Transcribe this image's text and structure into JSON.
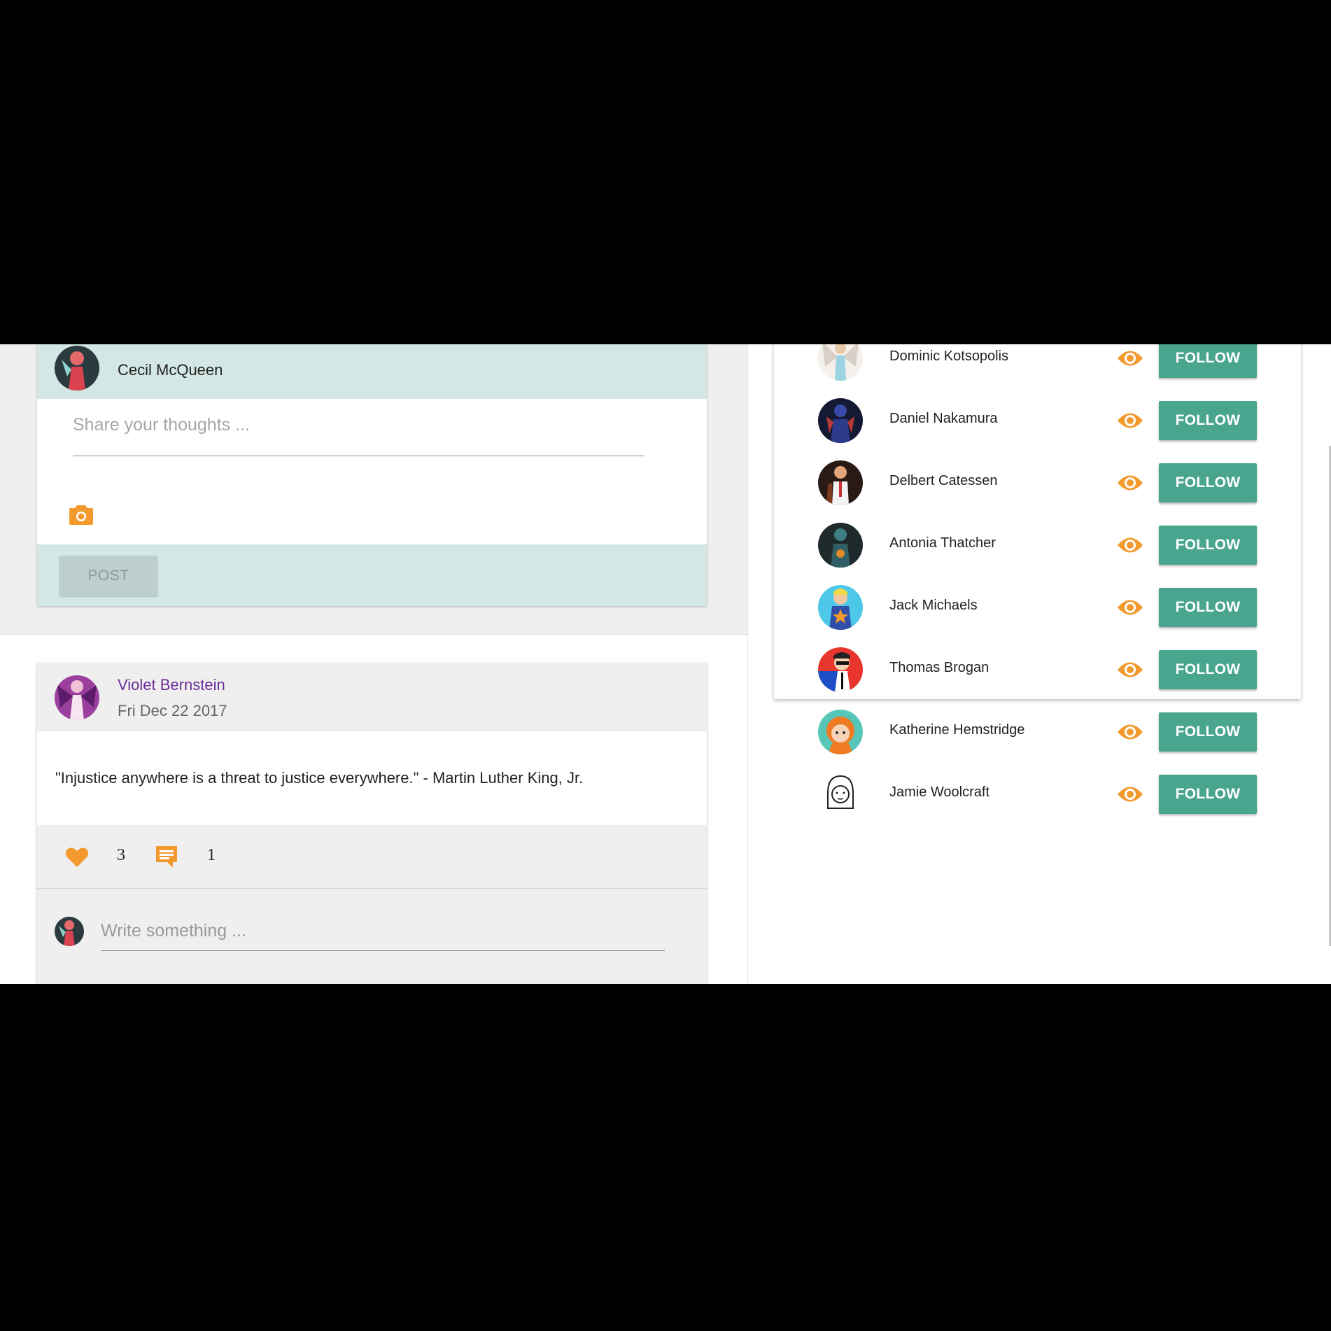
{
  "composer": {
    "user_name": "Cecil McQueen",
    "placeholder": "Share your thoughts ...",
    "post_label": "POST",
    "camera_icon": "camera-icon"
  },
  "post": {
    "author": "Violet Bernstein",
    "date": "Fri Dec 22 2017",
    "text": "\"Injustice anywhere is a threat to justice everywhere.\" - Martin Luther King, Jr.",
    "likes": "3",
    "comments": "1",
    "comment_placeholder": "Write something ..."
  },
  "suggestions": [
    {
      "name": "Dominic Kotsopolis",
      "follow": "FOLLOW"
    },
    {
      "name": "Daniel Nakamura",
      "follow": "FOLLOW"
    },
    {
      "name": "Delbert Catessen",
      "follow": "FOLLOW"
    },
    {
      "name": "Antonia Thatcher",
      "follow": "FOLLOW"
    },
    {
      "name": "Jack Michaels",
      "follow": "FOLLOW"
    },
    {
      "name": "Thomas Brogan",
      "follow": "FOLLOW"
    },
    {
      "name": "Katherine Hemstridge",
      "follow": "FOLLOW"
    },
    {
      "name": "Jamie Woolcraft",
      "follow": "FOLLOW"
    }
  ],
  "colors": {
    "accent_orange": "#f39a2f",
    "follow_green": "#4aa58e",
    "header_teal": "#d3e7e4",
    "author_purple": "#6a2f9a"
  }
}
